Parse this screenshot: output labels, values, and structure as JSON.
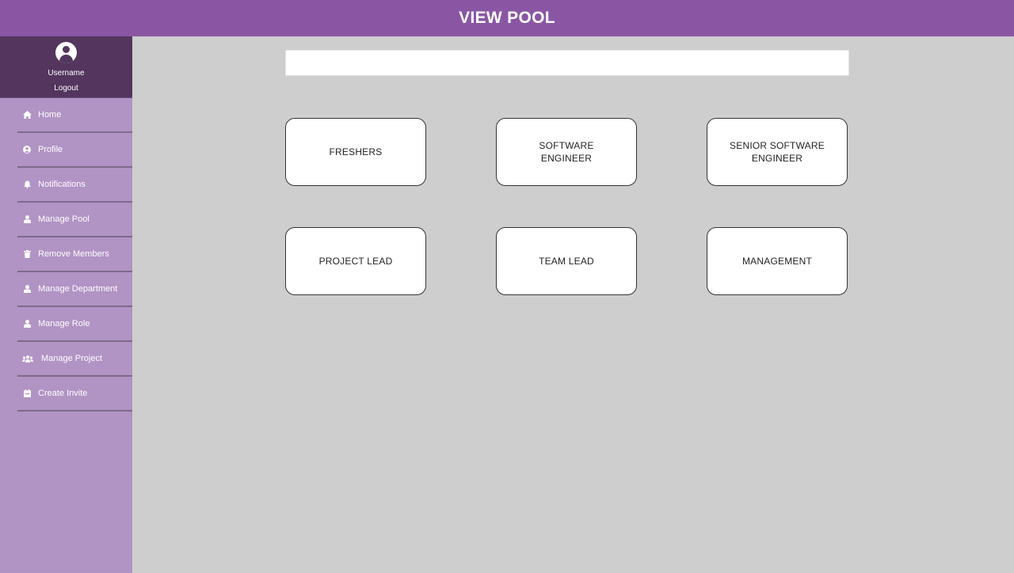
{
  "header": {
    "title": "VIEW POOL"
  },
  "user": {
    "name": "Username",
    "logout_label": "Logout"
  },
  "sidebar": {
    "items": [
      {
        "label": "Home",
        "icon": "home-icon"
      },
      {
        "label": "Profile",
        "icon": "user-circle-icon"
      },
      {
        "label": "Notifications",
        "icon": "bell-icon"
      },
      {
        "label": "Manage Pool",
        "icon": "user-icon"
      },
      {
        "label": "Remove Members",
        "icon": "trash-icon"
      },
      {
        "label": "Manage Department",
        "icon": "user-icon"
      },
      {
        "label": "Manage Role",
        "icon": "user-icon"
      },
      {
        "label": "Manage Project",
        "icon": "users-icon"
      },
      {
        "label": "Create Invite",
        "icon": "calendar-icon"
      }
    ]
  },
  "search": {
    "placeholder": "",
    "value": ""
  },
  "pools": [
    {
      "label": "FRESHERS"
    },
    {
      "label": "SOFTWARE ENGINEER"
    },
    {
      "label": "SENIOR SOFTWARE ENGINEER"
    },
    {
      "label": "PROJECT LEAD"
    },
    {
      "label": "TEAM LEAD"
    },
    {
      "label": "MANAGEMENT"
    }
  ],
  "colors": {
    "header": "#8a56a4",
    "sidebar": "#b193c4",
    "user_panel": "#53355e",
    "background": "#cecece"
  }
}
